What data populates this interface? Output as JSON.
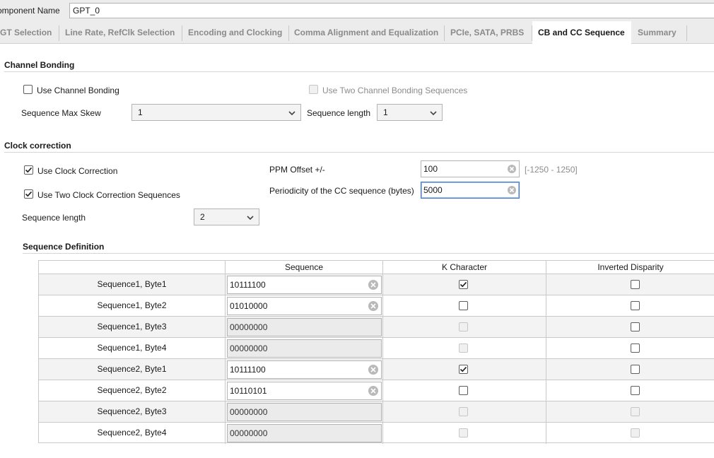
{
  "component": {
    "label": "omponent Name",
    "value": "GPT_0"
  },
  "tabs": [
    {
      "label": "GT Selection",
      "active": false
    },
    {
      "label": "Line Rate, RefClk Selection",
      "active": false
    },
    {
      "label": "Encoding and Clocking",
      "active": false
    },
    {
      "label": "Comma Alignment and Equalization",
      "active": false
    },
    {
      "label": "PCIe, SATA, PRBS",
      "active": false
    },
    {
      "label": "CB and CC Sequence",
      "active": true
    },
    {
      "label": "Summary",
      "active": false
    }
  ],
  "channel_bonding": {
    "title": "Channel Bonding",
    "use_channel_bonding": {
      "label": "Use Channel Bonding",
      "checked": false
    },
    "use_two_sequences": {
      "label": "Use Two Channel Bonding Sequences",
      "checked": false,
      "enabled": false
    },
    "max_skew": {
      "label": "Sequence Max Skew",
      "value": "1"
    },
    "sequence_length": {
      "label": "Sequence length",
      "value": "1"
    }
  },
  "clock_correction": {
    "title": "Clock correction",
    "use_clock_correction": {
      "label": "Use Clock Correction",
      "checked": true
    },
    "use_two_sequences": {
      "label": "Use Two Clock Correction Sequences",
      "checked": true
    },
    "sequence_length": {
      "label": "Sequence length",
      "value": "2"
    },
    "ppm_offset": {
      "label": "PPM Offset +/-",
      "value": "100",
      "range": "[-1250 - 1250]"
    },
    "periodicity": {
      "label": "Periodicity of the CC sequence (bytes)",
      "value": "5000"
    }
  },
  "sequence_definition": {
    "title": "Sequence Definition",
    "headers": [
      "",
      "Sequence",
      "K Character",
      "Inverted Disparity"
    ],
    "rows": [
      {
        "label": "Sequence1, Byte1",
        "value": "10111100",
        "editable": true,
        "k": true,
        "k_enabled": true,
        "inv": false,
        "inv_enabled": true
      },
      {
        "label": "Sequence1, Byte2",
        "value": "01010000",
        "editable": true,
        "k": false,
        "k_enabled": true,
        "inv": false,
        "inv_enabled": true
      },
      {
        "label": "Sequence1, Byte3",
        "value": "00000000",
        "editable": false,
        "k": false,
        "k_enabled": false,
        "inv": false,
        "inv_enabled": true
      },
      {
        "label": "Sequence1, Byte4",
        "value": "00000000",
        "editable": false,
        "k": false,
        "k_enabled": false,
        "inv": false,
        "inv_enabled": true
      },
      {
        "label": "Sequence2, Byte1",
        "value": "10111100",
        "editable": true,
        "k": true,
        "k_enabled": true,
        "inv": false,
        "inv_enabled": true
      },
      {
        "label": "Sequence2, Byte2",
        "value": "10110101",
        "editable": true,
        "k": false,
        "k_enabled": true,
        "inv": false,
        "inv_enabled": true
      },
      {
        "label": "Sequence2, Byte3",
        "value": "00000000",
        "editable": false,
        "k": false,
        "k_enabled": false,
        "inv": false,
        "inv_enabled": false
      },
      {
        "label": "Sequence2, Byte4",
        "value": "00000000",
        "editable": false,
        "k": false,
        "k_enabled": false,
        "inv": false,
        "inv_enabled": false
      }
    ]
  },
  "icons": {
    "clear": "clear-circle-icon",
    "dropdown": "chevron-down-icon",
    "check": "checkmark-icon"
  },
  "colors": {
    "focus": "#3c78d0",
    "disabled_text": "#8c8c8c",
    "tab_bar": "#ececec"
  }
}
